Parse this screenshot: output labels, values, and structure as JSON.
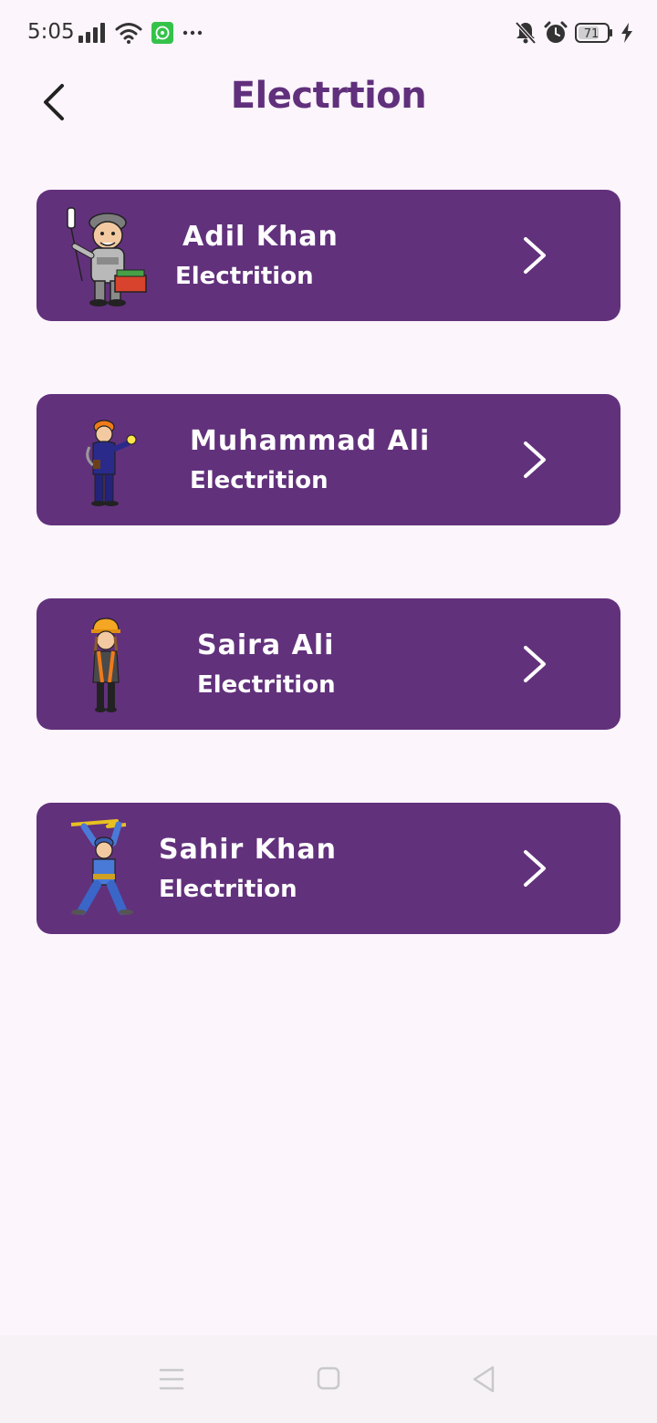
{
  "status_bar": {
    "time": "5:05",
    "battery": "71",
    "icons": [
      "signal-icon",
      "wifi-icon",
      "whatsapp-notification-icon",
      "more-dots-icon",
      "mute-bell-icon",
      "alarm-icon",
      "battery-icon",
      "charging-icon"
    ]
  },
  "header": {
    "title": "Electrtion",
    "back_icon": "back-arrow-icon"
  },
  "workers": [
    {
      "name": "Adil Khan",
      "role": "Electrition"
    },
    {
      "name": "Muhammad Ali",
      "role": "Electrition"
    },
    {
      "name": "Saira Ali",
      "role": "Electrition"
    },
    {
      "name": "Sahir Khan",
      "role": "Electrition"
    }
  ],
  "nav_bar": {
    "icons": [
      "menu-icon",
      "home-square-icon",
      "back-triangle-icon"
    ]
  },
  "colors": {
    "background": "#fcf5fc",
    "card": "#62317c",
    "title": "#61307c",
    "card_text": "#ffffff"
  }
}
